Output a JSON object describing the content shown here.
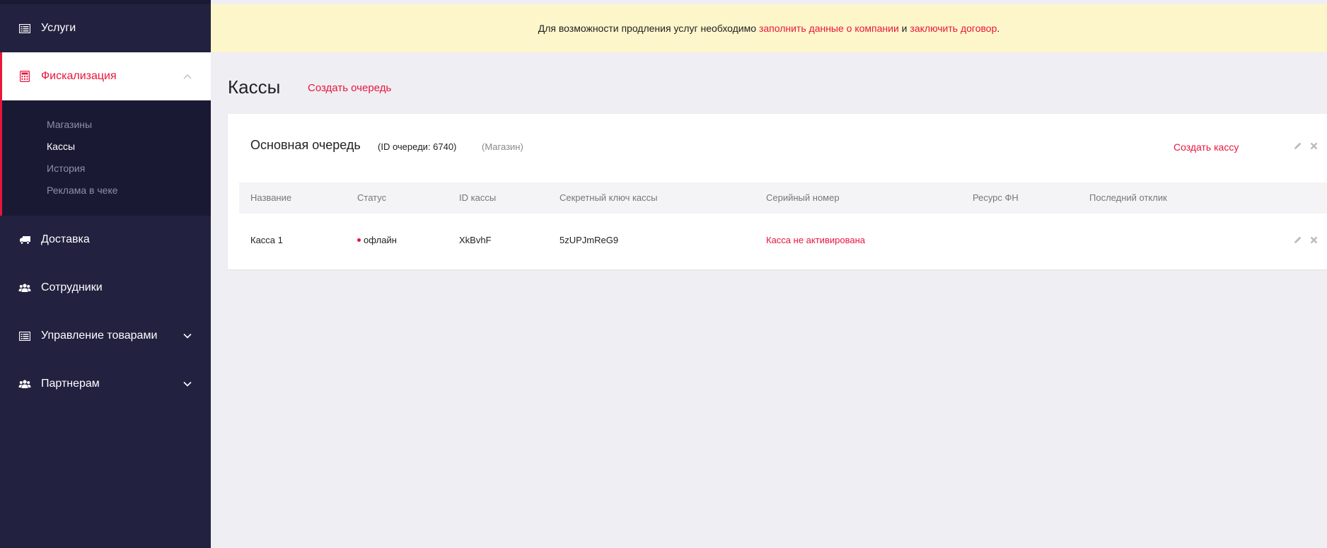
{
  "sidebar": {
    "items": [
      {
        "label": "Услуги",
        "icon": "list-icon"
      },
      {
        "label": "Фискализация",
        "icon": "calculator-icon"
      },
      {
        "label": "Доставка",
        "icon": "truck-icon"
      },
      {
        "label": "Сотрудники",
        "icon": "users-icon"
      },
      {
        "label": "Управление товарами",
        "icon": "list-icon"
      },
      {
        "label": "Партнерам",
        "icon": "users-icon"
      }
    ],
    "submenu": [
      "Магазины",
      "Кассы",
      "История",
      "Реклама в чеке"
    ]
  },
  "banner": {
    "text_before": "Для возможности продления услуг необходимо ",
    "link1": "заполнить данные о компании",
    "text_mid": " и ",
    "link2": "заключить договор",
    "text_after": "."
  },
  "page": {
    "title": "Кассы",
    "create_queue": "Создать очередь"
  },
  "queue": {
    "name": "Основная очередь",
    "id_text": "(ID очереди: 6740)",
    "type": "(Магазин)",
    "create_kassa": "Создать кассу"
  },
  "table": {
    "headers": [
      "Название",
      "Статус",
      "ID кассы",
      "Секретный ключ кассы",
      "Серийный номер",
      "Ресурс ФН",
      "Последний отклик"
    ],
    "rows": [
      {
        "name": "Касса 1",
        "status": "офлайн",
        "id": "XkBvhF",
        "secret": "5zUPJmReG9",
        "serial": "Касса не активирована",
        "resource": "",
        "last": ""
      }
    ]
  },
  "colors": {
    "accent": "#e8163b",
    "sidebar_bg": "#22213f",
    "banner_bg": "#fdf6cb"
  }
}
